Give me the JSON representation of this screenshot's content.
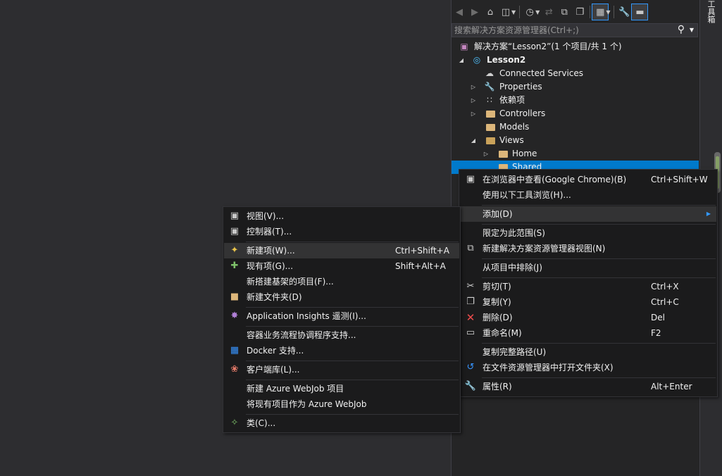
{
  "side_title": "工具箱",
  "toolbar": {
    "buttons": [
      "back-icon",
      "forward-icon",
      "home-icon",
      "switch-views-icon",
      "pending-changes-icon",
      "sync-icon",
      "collapse-all-icon",
      "show-all-files-icon",
      "preview-icon",
      "properties-icon",
      "pin-icon"
    ]
  },
  "search": {
    "placeholder": "搜索解决方案资源管理器(Ctrl+;)"
  },
  "tree": {
    "solution": "解决方案“Lesson2”(1 个项目/共 1 个)",
    "project": "Lesson2",
    "connected": "Connected Services",
    "properties": "Properties",
    "deps": "依赖项",
    "controllers": "Controllers",
    "models": "Models",
    "views": "Views",
    "home": "Home",
    "shared": "Shared"
  },
  "main_menu": {
    "view_in_browser": "在浏览器中查看(Google Chrome)(B)",
    "view_in_browser_sc": "Ctrl+Shift+W",
    "browse_with": "使用以下工具浏览(H)...",
    "add": "添加(D)",
    "scope": "限定为此范围(S)",
    "new_se_view": "新建解决方案资源管理器视图(N)",
    "exclude": "从项目中排除(J)",
    "cut": "剪切(T)",
    "cut_sc": "Ctrl+X",
    "copy": "复制(Y)",
    "copy_sc": "Ctrl+C",
    "delete": "删除(D)",
    "delete_sc": "Del",
    "rename": "重命名(M)",
    "rename_sc": "F2",
    "copy_path": "复制完整路径(U)",
    "open_folder": "在文件资源管理器中打开文件夹(X)",
    "props": "属性(R)",
    "props_sc": "Alt+Enter"
  },
  "add_menu": {
    "view": "视图(V)...",
    "controller": "控制器(T)...",
    "new_item": "新建项(W)...",
    "new_item_sc": "Ctrl+Shift+A",
    "existing_item": "现有项(G)...",
    "existing_item_sc": "Shift+Alt+A",
    "scaffold": "新搭建基架的项目(F)...",
    "new_folder": "新建文件夹(D)",
    "app_insights": "Application Insights 遥测(I)...",
    "orchestration": "容器业务流程协调程序支持...",
    "docker": "Docker 支持...",
    "client_lib": "客户端库(L)...",
    "new_webjob": "新建 Azure WebJob 项目",
    "existing_webjob": "将现有项目作为 Azure WebJob",
    "class": "类(C)..."
  }
}
